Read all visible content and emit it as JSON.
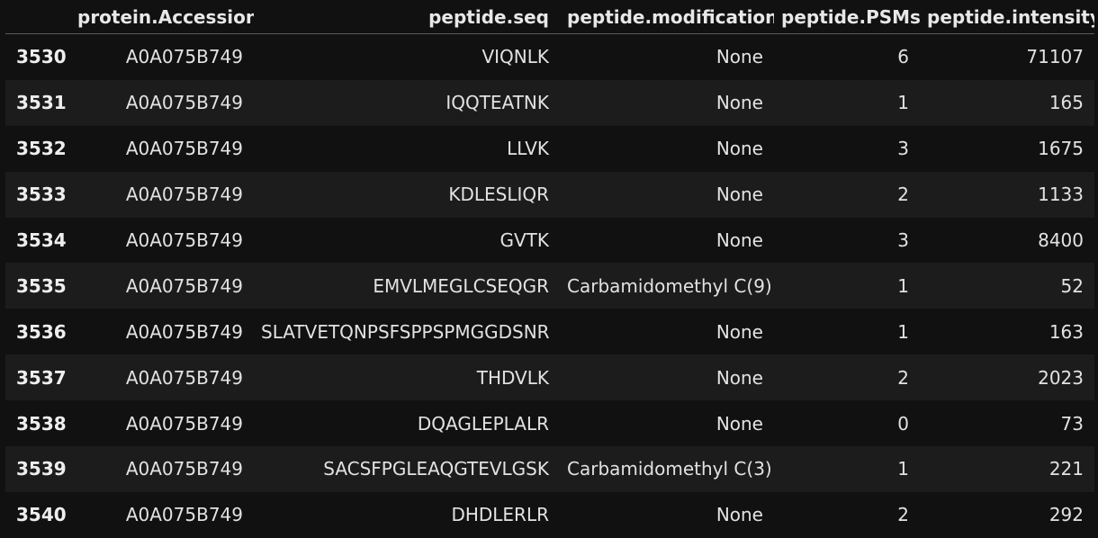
{
  "table": {
    "columns": [
      "",
      "protein.Accession",
      "peptide.seq",
      "peptide.modification",
      "peptide.PSMs",
      "peptide.intensity"
    ],
    "rows": [
      {
        "index": "3530",
        "accession": "A0A075B749",
        "seq": "VIQNLK",
        "modification": "None",
        "psms": "6",
        "intensity": "71107"
      },
      {
        "index": "3531",
        "accession": "A0A075B749",
        "seq": "IQQTEATNK",
        "modification": "None",
        "psms": "1",
        "intensity": "165"
      },
      {
        "index": "3532",
        "accession": "A0A075B749",
        "seq": "LLVK",
        "modification": "None",
        "psms": "3",
        "intensity": "1675"
      },
      {
        "index": "3533",
        "accession": "A0A075B749",
        "seq": "KDLESLIQR",
        "modification": "None",
        "psms": "2",
        "intensity": "1133"
      },
      {
        "index": "3534",
        "accession": "A0A075B749",
        "seq": "GVTK",
        "modification": "None",
        "psms": "3",
        "intensity": "8400"
      },
      {
        "index": "3535",
        "accession": "A0A075B749",
        "seq": "EMVLMEGLCSEQGR",
        "modification": "Carbamidomethyl C(9)",
        "psms": "1",
        "intensity": "52"
      },
      {
        "index": "3536",
        "accession": "A0A075B749",
        "seq": "SLATVETQNPSFSPPSPMGGDSNR",
        "modification": "None",
        "psms": "1",
        "intensity": "163"
      },
      {
        "index": "3537",
        "accession": "A0A075B749",
        "seq": "THDVLK",
        "modification": "None",
        "psms": "2",
        "intensity": "2023"
      },
      {
        "index": "3538",
        "accession": "A0A075B749",
        "seq": "DQAGLEPLALR",
        "modification": "None",
        "psms": "0",
        "intensity": "73"
      },
      {
        "index": "3539",
        "accession": "A0A075B749",
        "seq": "SACSFPGLEAQGTEVLGSK",
        "modification": "Carbamidomethyl C(3)",
        "psms": "1",
        "intensity": "221"
      },
      {
        "index": "3540",
        "accession": "A0A075B749",
        "seq": "DHDLERLR",
        "modification": "None",
        "psms": "2",
        "intensity": "292"
      }
    ]
  },
  "colors": {
    "background": "#111111",
    "row_alt": "#1c1c1c",
    "text": "#e2e2e2",
    "header_rule": "#5a5a5a"
  }
}
